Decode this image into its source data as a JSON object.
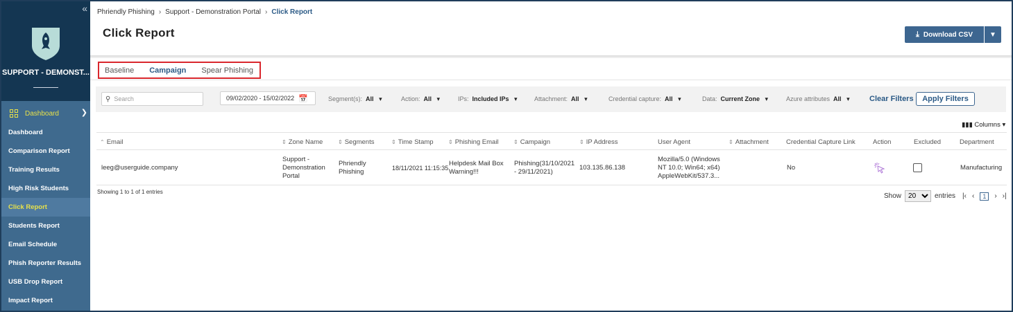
{
  "sidebar": {
    "org_name": "SUPPORT - DEMONST...",
    "dashboard_label": "Dashboard",
    "items": [
      {
        "label": "Dashboard"
      },
      {
        "label": "Comparison Report"
      },
      {
        "label": "Training Results"
      },
      {
        "label": "High Risk Students"
      },
      {
        "label": "Click Report"
      },
      {
        "label": "Students Report"
      },
      {
        "label": "Email Schedule"
      },
      {
        "label": "Phish Reporter Results"
      },
      {
        "label": "USB Drop Report"
      },
      {
        "label": "Impact Report"
      }
    ],
    "active_item": "Click Report"
  },
  "breadcrumb": {
    "items": [
      "Phriendly Phishing",
      "Support - Demonstration Portal",
      "Click Report"
    ]
  },
  "header": {
    "title": "Click Report",
    "download_label": "Download CSV"
  },
  "tabs": [
    {
      "label": "Baseline"
    },
    {
      "label": "Campaign",
      "active": true
    },
    {
      "label": "Spear Phishing"
    }
  ],
  "filters": {
    "search_placeholder": "Search",
    "date_range": "09/02/2020 - 15/02/2022",
    "segments": {
      "label": "Segment(s):",
      "value": "All"
    },
    "action": {
      "label": "Action:",
      "value": "All"
    },
    "ips": {
      "label": "IPs:",
      "value": "Included IPs"
    },
    "attachment": {
      "label": "Attachment:",
      "value": "All"
    },
    "credential": {
      "label": "Credential capture:",
      "value": "All"
    },
    "data": {
      "label": "Data:",
      "value": "Current Zone"
    },
    "azure": {
      "label": "Azure attributes",
      "value": "All"
    },
    "clear_label": "Clear Filters",
    "apply_label": "Apply Filters"
  },
  "columns_label": "Columns",
  "table": {
    "headers": [
      "Email",
      "Zone Name",
      "Segments",
      "Time Stamp",
      "Phishing Email",
      "Campaign",
      "IP Address",
      "User Agent",
      "Attachment",
      "Credential Capture Link",
      "Action",
      "Excluded",
      "Department"
    ],
    "rows": [
      {
        "email": "leeg@userguide.company",
        "zone": [
          "Support -",
          "Demonstration",
          "Portal"
        ],
        "segments": [
          "Phriendly",
          "Phishing"
        ],
        "timestamp": "18/11/2021 11:15:35",
        "phishing_email": [
          "Helpdesk Mail Box",
          "Warning!!!"
        ],
        "campaign": [
          "Phishing(31/10/2021",
          "- 29/11/2021)"
        ],
        "ip": "103.135.86.138",
        "user_agent": [
          "Mozilla/5.0 (Windows",
          "NT 10.0; Win64; x64)",
          "AppleWebKit/537.3..."
        ],
        "attachment": "",
        "credential": "No",
        "excluded": false,
        "department": "Manufacturing"
      }
    ]
  },
  "footer": {
    "showing": "Showing 1 to 1 of 1 entries",
    "show_label": "Show",
    "page_size": "20",
    "entries_label": "entries",
    "current_page": "1"
  },
  "colors": {
    "sidebar_dark": "#143652",
    "sidebar": "#3f6a8e",
    "accent": "#3d6690",
    "highlight": "#e8e14a",
    "tab_outline": "#d9262c"
  }
}
